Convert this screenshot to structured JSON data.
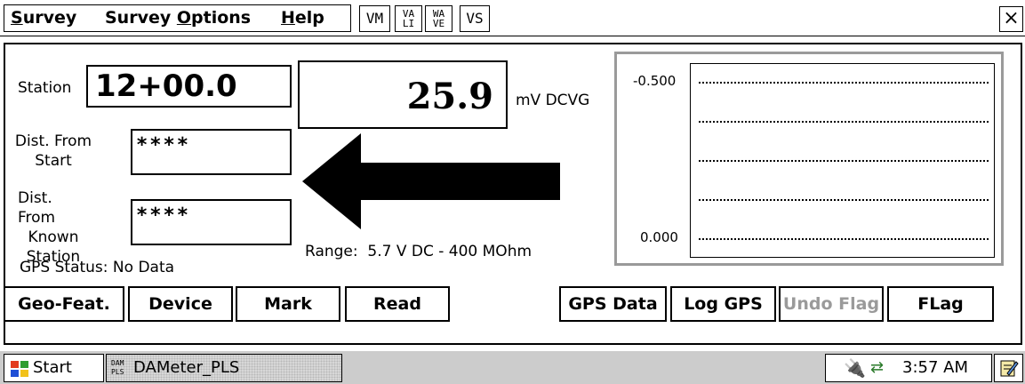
{
  "menu": {
    "survey": {
      "hot": "S",
      "rest": "urvey"
    },
    "survey_options": {
      "pre": "Survey ",
      "hot": "O",
      "rest": "ptions"
    },
    "help": {
      "hot": "H",
      "rest": "elp"
    }
  },
  "toolbar": {
    "vm": "VM",
    "vali": {
      "top": "VA",
      "bottom": "LI"
    },
    "wave": {
      "top": "WA",
      "bottom": "VE"
    },
    "vs": "VS",
    "close": "×"
  },
  "station": {
    "label": "Station",
    "value": "12+00.0"
  },
  "reading": {
    "value": "25.9",
    "unit": "mV DCVG"
  },
  "dist_from_start": {
    "label_line1": "Dist. From",
    "label_line2": "Start",
    "value": "****"
  },
  "dist_from_known": {
    "label_line1": "Dist. From",
    "label_line2": "Known",
    "label_line3": "Station",
    "value": "****"
  },
  "range": "Range:  5.7 V DC - 400 MOhm",
  "gps_status": "GPS Status: No Data",
  "graph": {
    "y_top": "-0.500",
    "y_bottom": "0.000"
  },
  "buttons": {
    "geo_feat": "Geo-Feat.",
    "device": "Device",
    "mark": "Mark",
    "read": "Read",
    "gps_data": "GPS Data",
    "log_gps": "Log GPS",
    "undo_flag": "Undo Flag",
    "flag": "FLag"
  },
  "taskbar": {
    "start": "Start",
    "app_icon_top": "DAM",
    "app_icon_bottom": "PLS",
    "app": "DAMeter_PLS",
    "time": "3:57 AM"
  },
  "colors": {
    "disabled": "#9a9a9a",
    "taskbar": "#cccccc",
    "graph_frame": "#9a9a9a"
  }
}
